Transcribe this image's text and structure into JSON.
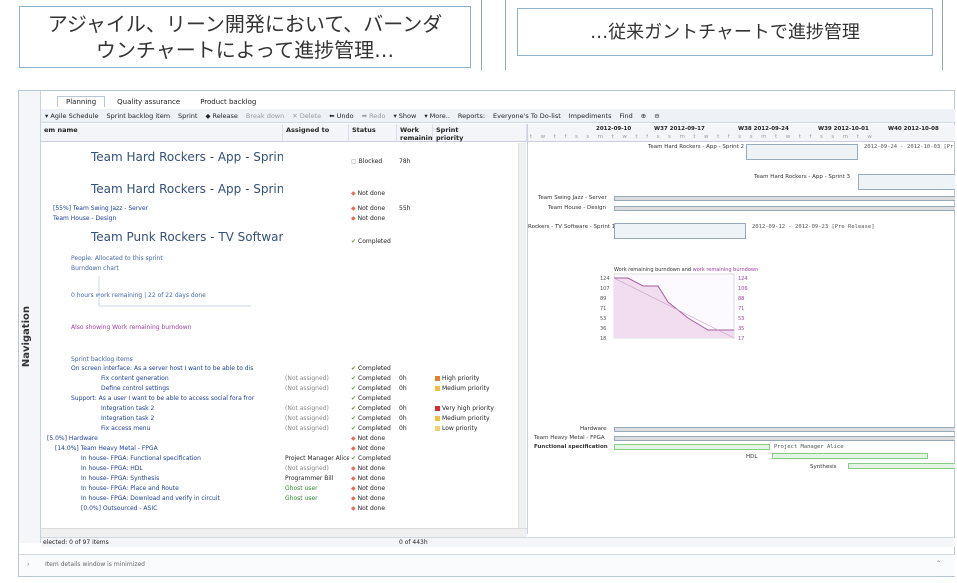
{
  "callouts": {
    "left_line1": "アジャイル、リーン開発において、バーンダ",
    "left_line2": "ウンチャートによって進捗管理…",
    "right": "…従来ガントチャートで進捗管理"
  },
  "nav": {
    "label": "Navigation"
  },
  "tabs": [
    "Planning",
    "Quality assurance",
    "Product backlog"
  ],
  "toolbar": [
    "▾ Agile Schedule",
    "Sprint backlog item",
    "Sprint",
    "◆ Release",
    "Break down",
    "✕ Delete",
    "⬅ Undo",
    "➡ Redo",
    "▾ Show",
    "▾ More..",
    "Reports:",
    "Everyone's To Do-list",
    "Impediments",
    "Find",
    "⊕",
    "⊖"
  ],
  "columns": {
    "name": "em name",
    "assigned": "Assigned to",
    "status": "Status",
    "work1": "Work",
    "work2": "remaining",
    "prio1": "Sprint",
    "prio2": "priority"
  },
  "rows": [
    {
      "name": "Team Hard Rockers - App - Sprint",
      "status": "Blocked",
      "work": "78h",
      "big": true
    },
    {
      "name": "Team Hard Rockers - App - Sprint",
      "status": "Not done",
      "big": true
    },
    {
      "name": "[55%] Team Swing Jazz - Server",
      "status": "Not done",
      "work": "55h"
    },
    {
      "name": "Team House - Design",
      "status": "Not done"
    },
    {
      "name": "Team Punk Rockers - TV Software -",
      "status": "Completed",
      "big": true
    },
    {
      "name": "People: Allocated to this sprint"
    },
    {
      "name": "Burndown chart"
    },
    {
      "name": "0 hours work remaining | 22 of 22 days done"
    },
    {
      "name": "Also showing Work remaining burndown"
    },
    {
      "name": "Sprint backlog items"
    },
    {
      "name": "On screen interface: As a server host I want to be able to dis",
      "status": "Completed"
    },
    {
      "name": "Fix content generation",
      "assigned": "(Not assigned)",
      "status": "Completed",
      "work": "0h",
      "prio": "High priority",
      "pc": "#e08030"
    },
    {
      "name": "Define control settings",
      "assigned": "(Not assigned)",
      "status": "Completed",
      "work": "0h",
      "prio": "Medium priority",
      "pc": "#f0c040"
    },
    {
      "name": "Support: As a user I want to be able to access social fora fror",
      "status": "Completed"
    },
    {
      "name": "Integration task 2",
      "assigned": "(Not assigned)",
      "status": "Completed",
      "work": "0h",
      "prio": "Very high priority",
      "pc": "#d03030"
    },
    {
      "name": "Integration task 2",
      "assigned": "(Not assigned)",
      "status": "Completed",
      "work": "0h",
      "prio": "Medium priority",
      "pc": "#f0c040"
    },
    {
      "name": "Fix access menu",
      "assigned": "(Not assigned)",
      "status": "Completed",
      "work": "0h",
      "prio": "Low priority",
      "pc": "#f0d070"
    },
    {
      "name": "[5.0%] Hardware",
      "status": "Not done"
    },
    {
      "name": "[14.0%] Team Heavy Metal - FPGA",
      "status": "Not done"
    },
    {
      "name": "In house- FPGA: Functional specification",
      "assigned": "Project Manager Alice",
      "status": "Completed"
    },
    {
      "name": "In house- FPGA: HDL",
      "assigned": "(Not assigned)",
      "status": "Not done"
    },
    {
      "name": "In house- FPGA: Synthesis",
      "assigned": "Programmer Bill",
      "status": "Not done"
    },
    {
      "name": "In house- FPGA: Place and Route",
      "assigned": "Ghost user",
      "status": "Not done"
    },
    {
      "name": "In house- FPGA: Download and verify in circuit",
      "assigned": "Ghost user",
      "status": "Not done"
    },
    {
      "name": "[0.0%] Outsourced - ASIC",
      "status": "Not done"
    }
  ],
  "gantt": {
    "dates": [
      "2012-09-10",
      "W37 2012-09-17",
      "W38 2012-09-24",
      "W39 2012-10-01",
      "W40 2012-10-08"
    ],
    "days": "t w t f s s m t w t f s s m t w t f s s m t w t f s s m t w",
    "labels": {
      "hr1": "Team Hard Rockers - App - Sprint 2",
      "hr1_dates": "2012-09-24 - 2012-10-03 [Pr",
      "hr2": "Team Hard Rockers - App - Sprint 3",
      "swing": "Team Swing Jazz - Server",
      "house": "Team House - Design",
      "punk": "Rockers - TV Software - Sprint 1",
      "punk_dates": "2012-09-12 - 2012-09-23 [Pre Release]",
      "hardware": "Hardware",
      "heavy": "Team Heavy Metal - FPGA",
      "func": "Functional specification",
      "alice": "Project Manager Alice",
      "hdl": "HDL",
      "synth": "Synthesis"
    },
    "burndown_title_a": "Work remaining burndown and ",
    "burndown_title_b": "work remaining burndown",
    "yticks": [
      "124",
      "107",
      "89",
      "71",
      "53",
      "36",
      "18"
    ],
    "yticks_r": [
      "124",
      "106",
      "88",
      "71",
      "53",
      "35",
      "17"
    ]
  },
  "status": {
    "selected": "elected: 0 of 97 items",
    "hours": "0 of 443h"
  },
  "details": "Item details window is minimized"
}
